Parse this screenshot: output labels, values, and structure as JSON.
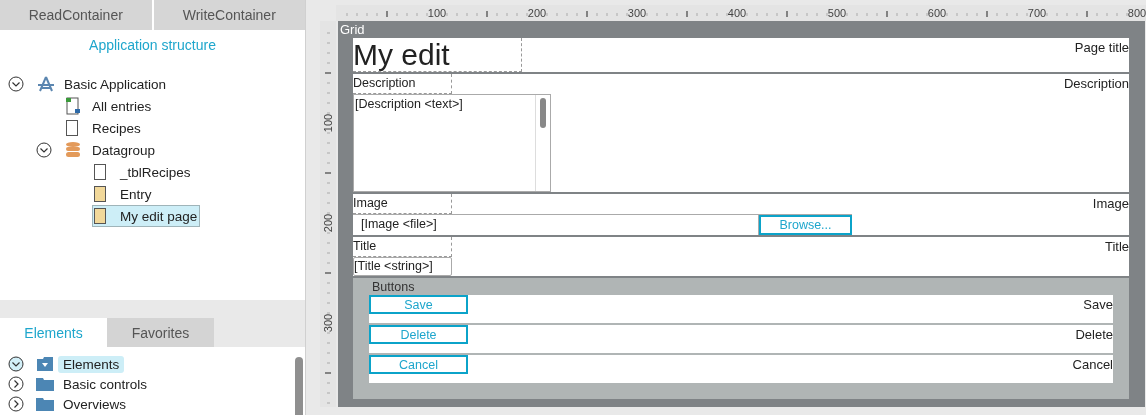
{
  "left_panel": {
    "top_tabs": [
      {
        "label": "ReadContainer"
      },
      {
        "label": "WriteContainer"
      }
    ],
    "heading": "Application structure",
    "tree": [
      {
        "label": "Basic Application",
        "kind": "app",
        "expanded": true,
        "selected": false,
        "children": [
          {
            "label": "All entries",
            "kind": "overview",
            "selected": false
          },
          {
            "label": "Recipes",
            "kind": "page",
            "selected": false
          },
          {
            "label": "Datagroup",
            "kind": "database",
            "expanded": true,
            "selected": false,
            "children": [
              {
                "label": "_tblRecipes",
                "kind": "page",
                "selected": false
              },
              {
                "label": "Entry",
                "kind": "form",
                "selected": false
              },
              {
                "label": "My edit page",
                "kind": "form",
                "selected": true
              }
            ]
          }
        ]
      }
    ],
    "bottom_tabs": [
      {
        "label": "Elements",
        "selected": true
      },
      {
        "label": "Favorites",
        "selected": false
      }
    ],
    "elements_tree": [
      {
        "label": "Elements",
        "kind": "folder-down",
        "expanded": true,
        "selected": true
      },
      {
        "label": "Basic controls",
        "kind": "folder",
        "expanded": false,
        "selected": false
      },
      {
        "label": "Overviews",
        "kind": "folder",
        "expanded": false,
        "selected": false
      }
    ]
  },
  "designer": {
    "ruler": {
      "x_labels": [
        "100",
        "200",
        "300",
        "400",
        "500",
        "600",
        "700",
        "800"
      ],
      "y_labels": [
        "100",
        "200",
        "300"
      ]
    },
    "grid": {
      "title": "Grid",
      "rows": [
        {
          "kind": "heading",
          "value": "My edit",
          "caption": "Page title"
        },
        {
          "kind": "textarea",
          "label": "Description",
          "value": "[Description <text>]",
          "caption": "Description"
        },
        {
          "kind": "file",
          "label": "Image",
          "value": "[Image <file>]",
          "button": "Browse...",
          "caption": "Image"
        },
        {
          "kind": "string",
          "label": "Title",
          "value": "[Title <string>]",
          "caption": "Title"
        }
      ],
      "buttons_group": {
        "title": "Buttons",
        "rows": [
          {
            "button": "Save",
            "caption": "Save"
          },
          {
            "button": "Delete",
            "caption": "Delete"
          },
          {
            "button": "Cancel",
            "caption": "Cancel"
          }
        ]
      }
    }
  }
}
